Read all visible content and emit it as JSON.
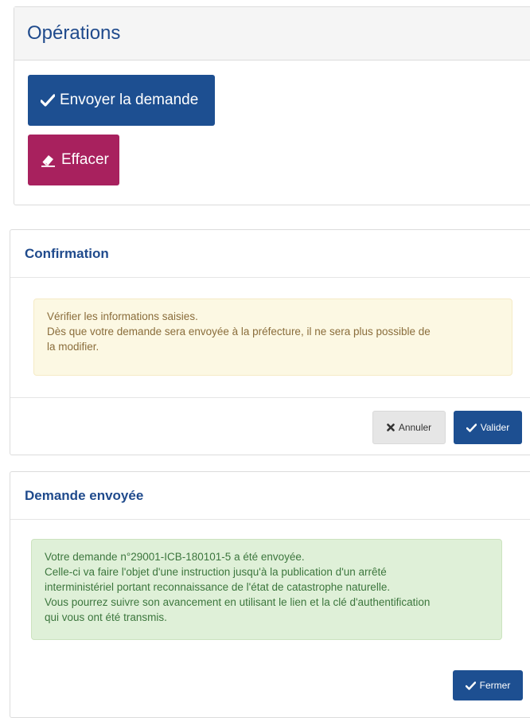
{
  "operations": {
    "title": "Opérations",
    "send_label": "Envoyer la demande",
    "clear_label": "Effacer"
  },
  "confirmation": {
    "title": "Confirmation",
    "message_lines": [
      "Vérifier les informations saisies.",
      "Dès que votre demande sera envoyée à la préfecture, il ne sera plus possible de",
      "la modifier."
    ],
    "cancel_label": "Annuler",
    "validate_label": "Valider"
  },
  "sent": {
    "title": "Demande envoyée",
    "message_lines": [
      "Votre demande n°29001-ICB-180101-5 a été envoyée.",
      "Celle-ci va faire l'objet d'une instruction jusqu'à la publication d'un arrêté",
      "interministériel portant reconnaissance de l'état de catastrophe naturelle.",
      "Vous pourrez suivre son avancement en utilisant le lien et la clé d'authentification",
      "qui vous ont été transmis."
    ],
    "close_label": "Fermer"
  },
  "icons": {
    "send": "check-icon",
    "clear": "eraser-icon",
    "cancel": "times-icon",
    "validate": "check-icon",
    "close": "check-icon"
  },
  "colors": {
    "primary": "#1d4f91",
    "danger": "#a8215e",
    "title": "#1f4a8c",
    "warning_bg": "#fcf8e3",
    "success_bg": "#dff0d8"
  }
}
